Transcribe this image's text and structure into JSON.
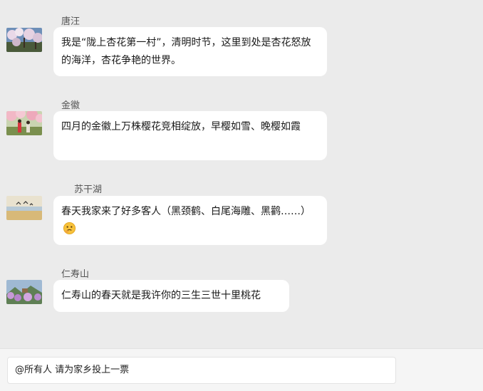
{
  "messages": [
    {
      "sender": "唐汪",
      "avatar": "apricot-blossom-photo-icon",
      "text": "我是“陇上杏花第一村”，清明时节，这里到处是杏花怒放的海洋，杏花争艳的世界。"
    },
    {
      "sender": "金徽",
      "avatar": "cherry-blossom-photo-icon",
      "text": "四月的金徽上万株樱花竞相绽放，早樱如雪、晚樱如霞"
    },
    {
      "sender": "苏干湖",
      "avatar": "lake-birds-photo-icon",
      "text": "春天我家来了好多客人（黑颈鹤、白尾海雕、黑鹳……）",
      "emoji": "thinking-face-emoji-icon"
    },
    {
      "sender": "仁寿山",
      "avatar": "mountain-peach-blossom-photo-icon",
      "text": "仁寿山的春天就是我许你的三生三世十里桃花"
    }
  ],
  "input": {
    "value": "@所有人  请为家乡投上一票"
  },
  "colors": {
    "background": "#ebebeb",
    "bubble": "#ffffff",
    "sender_text": "#555555",
    "message_text": "#1a1a1a"
  }
}
